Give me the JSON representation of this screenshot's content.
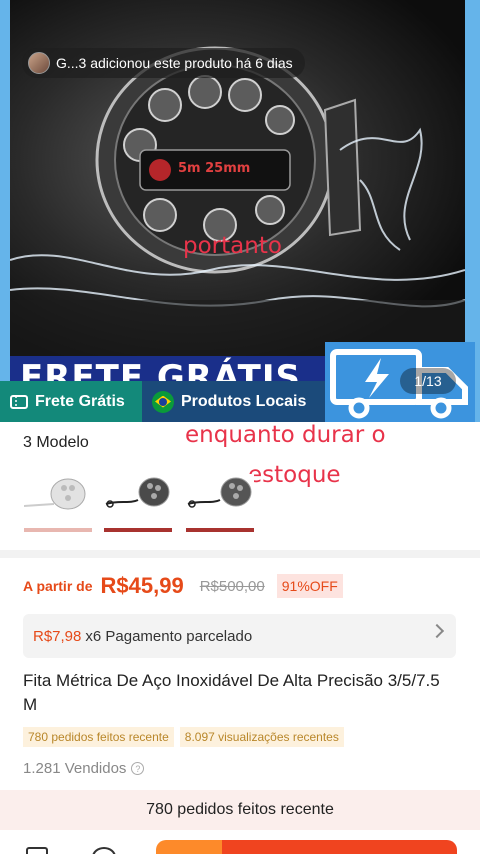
{
  "hero": {
    "added_by_text": "G...3 adicionou este produto há 6 dias",
    "overlay_word_1": "portanto",
    "overlay_word_2_line1": "enquanto durar o",
    "overlay_word_2_line2": "estoque",
    "banner_text": "FRETE GRÁTIS",
    "product_label": "5m 25mm",
    "image_counter": "1/13"
  },
  "tags": {
    "free_shipping": "Frete Grátis",
    "local_products": "Produtos Locais"
  },
  "models": {
    "title": "3 Modelo",
    "count": 3
  },
  "price": {
    "from_label": "A partir de",
    "current": "R$45,99",
    "original": "R$500,00",
    "discount": "91%OFF"
  },
  "installment": {
    "amount": "R$7,98",
    "text": "x6 Pagamento parcelado"
  },
  "product": {
    "title": "Fita Métrica De Aço Inoxidável De Alta Precisão 3/5/7.5 M",
    "chip_orders": "780 pedidos feitos recente",
    "chip_views": "8.097 visualizações recentes",
    "sold": "1.281 Vendidos",
    "help_glyph": "?"
  },
  "bottom": {
    "notice": "780 pedidos feitos recente"
  },
  "colors": {
    "accent": "#e64a19",
    "buy_button": "#f0441f",
    "cart_button": "#fd8a2a",
    "free_tag": "#13897a",
    "local_tag": "#1b4a7a",
    "truck_panel": "#3c94de"
  }
}
